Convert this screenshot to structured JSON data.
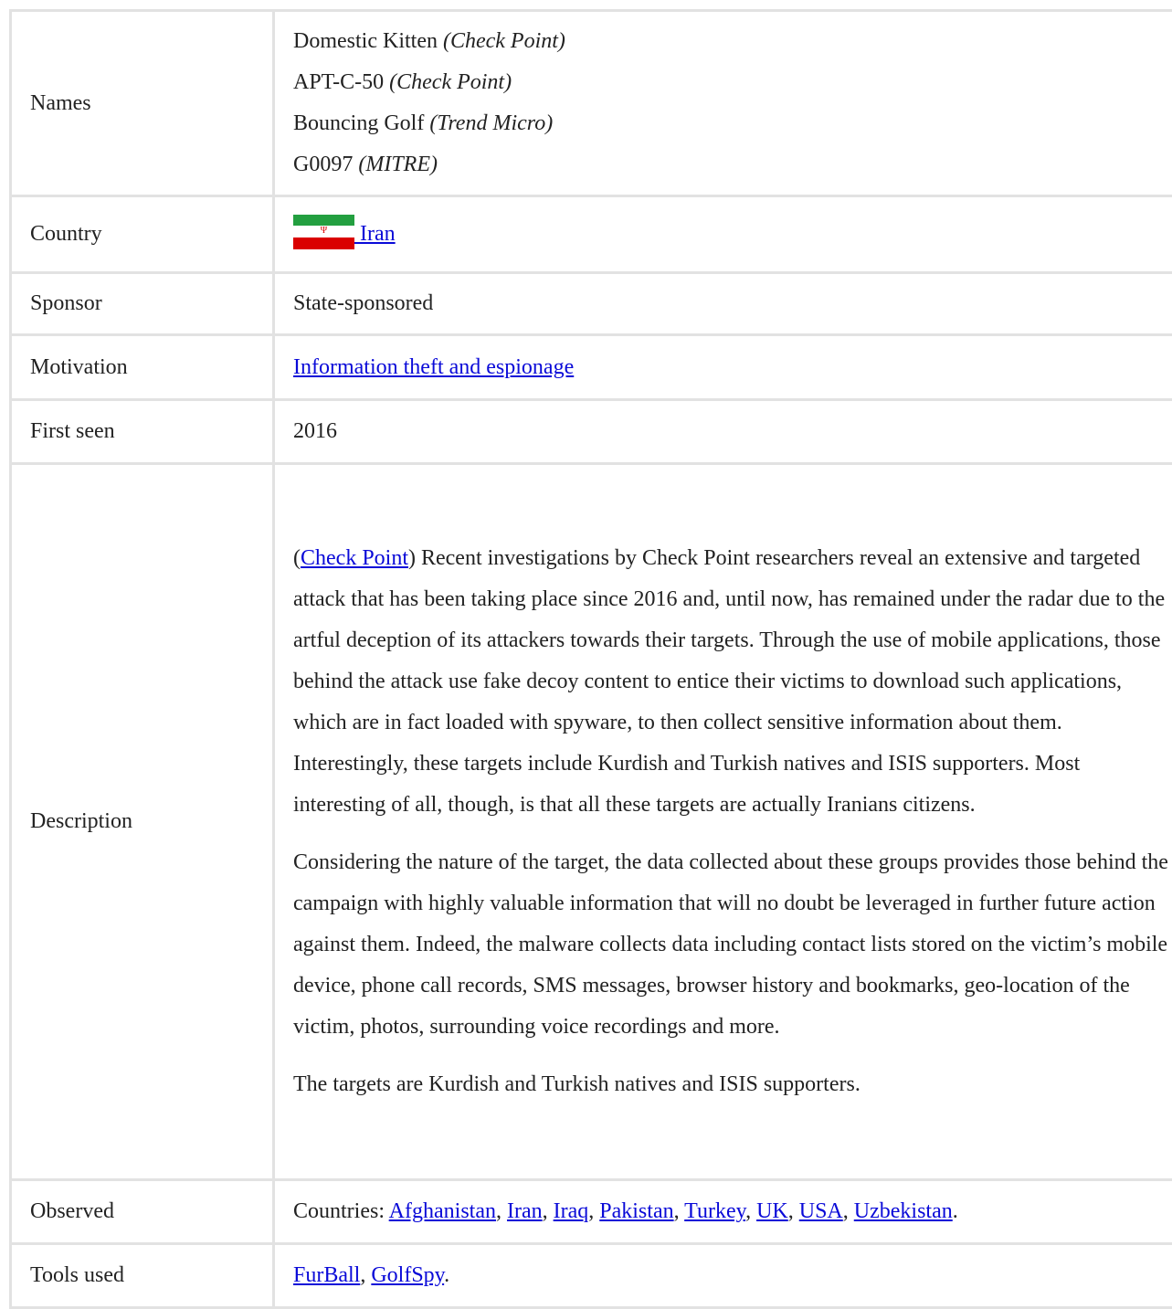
{
  "rows": {
    "names": {
      "label": "Names",
      "items": [
        {
          "name": "Domestic Kitten",
          "source": "(Check Point)"
        },
        {
          "name": "APT-C-50",
          "source": "(Check Point)"
        },
        {
          "name": "Bouncing Golf",
          "source": "(Trend Micro)"
        },
        {
          "name": "G0097",
          "source": "(MITRE)"
        }
      ]
    },
    "country": {
      "label": "Country",
      "value": " Iran",
      "flag_icon": "iran-flag-icon"
    },
    "sponsor": {
      "label": "Sponsor",
      "value": "State-sponsored"
    },
    "motivation": {
      "label": "Motivation",
      "value": "Information theft and espionage"
    },
    "first_seen": {
      "label": "First seen",
      "value": "2016"
    },
    "description": {
      "label": "Description",
      "link": "Check Point",
      "p1_open": "(",
      "p1_rest": ") Recent investigations by Check Point researchers reveal an extensive and targeted attack that has been taking place since 2016 and, until now, has remained under the radar due to the artful deception of its attackers towards their targets. Through the use of mobile applications, those behind the attack use fake decoy content to entice their victims to download such applications, which are in fact loaded with spyware, to then collect sensitive information about them. Interestingly, these targets include Kurdish and Turkish natives and ISIS supporters. Most interesting of all, though, is that all these targets are actually Iranians citizens.",
      "p2": "Considering the nature of the target, the data collected about these groups provides those behind the campaign with highly valuable information that will no doubt be leveraged in further future action against them. Indeed, the malware collects data including contact lists stored on the victim’s mobile device, phone call records, SMS messages, browser history and bookmarks, geo-location of the victim, photos, surrounding voice recordings and more.",
      "p3": "The targets are Kurdish and Turkish natives and ISIS supporters."
    },
    "observed": {
      "label": "Observed",
      "prefix": "Countries: ",
      "countries": [
        "Afghanistan",
        "Iran",
        "Iraq",
        "Pakistan",
        "Turkey",
        "UK",
        "USA",
        "Uzbekistan"
      ],
      "sep": ", ",
      "end": "."
    },
    "tools": {
      "label": "Tools used",
      "items": [
        "FurBall",
        "GolfSpy"
      ],
      "sep": ", ",
      "end": "."
    }
  },
  "colors": {
    "link": "#0a0ad8",
    "border": "#e2e2e2",
    "text": "#222222"
  }
}
